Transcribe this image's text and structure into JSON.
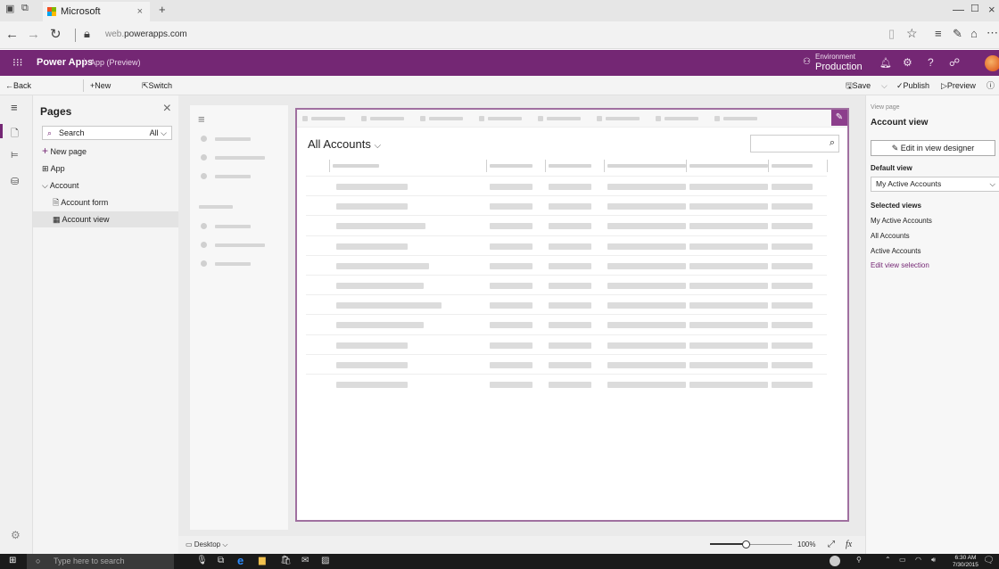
{
  "browser": {
    "tab_title": "Microsoft",
    "tab_close": "×",
    "new_tab": "+",
    "url_prefix": "web.",
    "url_domain": "powerapps.com",
    "window_controls": [
      "—",
      "☐",
      "×"
    ]
  },
  "app_bar": {
    "brand": "Power Apps",
    "subtitle": "App (Preview)",
    "environment_label": "Environment",
    "environment_value": "Production",
    "accent_color": "#742774"
  },
  "command_bar": {
    "back": "Back to Home",
    "new_page": "New page",
    "switch_classic": "Switch to classic",
    "save": "Save",
    "publish": "Publish",
    "preview": "Preview"
  },
  "pages_panel": {
    "title": "Pages",
    "search_placeholder": "Search",
    "filter": "All",
    "new_page": "New page",
    "items": [
      {
        "label": "App"
      },
      {
        "label": "Account"
      },
      {
        "label": "Account form"
      },
      {
        "label": "Account view"
      }
    ]
  },
  "canvas": {
    "view_title": "All Accounts",
    "device": "Desktop",
    "zoom": "100%",
    "zoom_level": 0.45,
    "fx": "fx"
  },
  "right_panel": {
    "header_small": "View page",
    "header": "Account view",
    "edit_button": "Edit in view designer",
    "default_view_label": "Default view",
    "default_view_value": "My Active Accounts",
    "selected_views_label": "Selected views",
    "selected_views": [
      "My Active Accounts",
      "All Accounts",
      "Active Accounts"
    ],
    "edit_selection_link": "Edit view selection",
    "link_color": "#742774"
  },
  "taskbar": {
    "search_placeholder": "Type here to search",
    "time": "6:30 AM",
    "date": "7/30/2015"
  }
}
